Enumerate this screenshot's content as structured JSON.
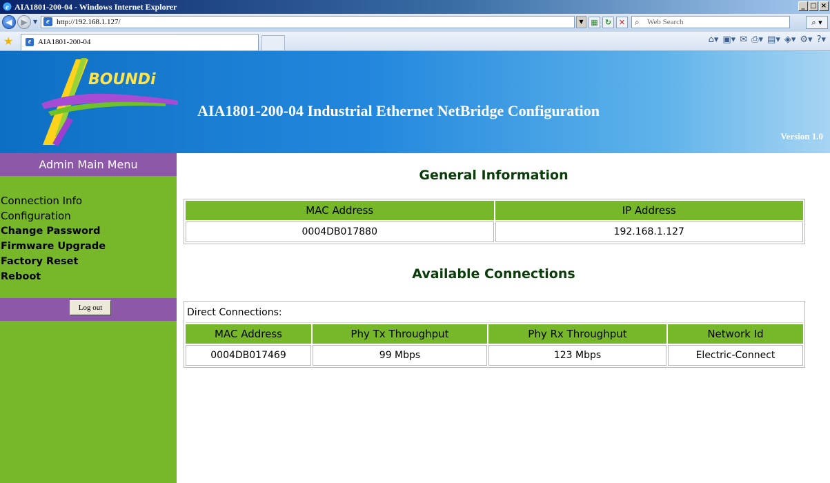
{
  "browser": {
    "window_title": "AIA1801-200-04 - Windows Internet Explorer",
    "url": "http://192.168.1.127/",
    "search_placeholder": "Web Search",
    "tab_label": "AIA1801-200-04",
    "window_buttons": {
      "minimize": "_",
      "maximize": "□",
      "close": "×"
    }
  },
  "banner": {
    "logo_text": "BOUNDi",
    "title": "AIA1801-200-04 Industrial Ethernet NetBridge Configuration",
    "version": "Version 1.0",
    "colors": {
      "banner_start": "#0d6fc4",
      "banner_end": "#a7d4f2"
    }
  },
  "sidebar": {
    "header": "Admin Main Menu",
    "items": [
      {
        "label": "Connection Info"
      },
      {
        "label": "Configuration"
      },
      {
        "label": "Change Password"
      },
      {
        "label": "Firmware Upgrade"
      },
      {
        "label": "Factory Reset"
      },
      {
        "label": "Reboot"
      }
    ],
    "logout_label": "Log out",
    "colors": {
      "menu_bg": "#76b82a",
      "header_bg": "#8e58a8"
    }
  },
  "general": {
    "title": "General Information",
    "columns": [
      "MAC Address",
      "IP Address"
    ],
    "row": [
      "0004DB017880",
      "192.168.1.127"
    ]
  },
  "connections": {
    "title": "Available Connections",
    "caption": "Direct Connections:",
    "columns": [
      "MAC Address",
      "Phy Tx Throughput",
      "Phy Rx Throughput",
      "Network Id"
    ],
    "rows": [
      [
        "0004DB017469",
        "99 Mbps",
        "123 Mbps",
        "Electric-Connect"
      ]
    ]
  },
  "icons": [
    "ie-logo",
    "back-arrow-icon",
    "forward-arrow-icon",
    "refresh-icon",
    "stop-icon",
    "search-icon",
    "favorites-star-icon",
    "home-icon",
    "feeds-icon",
    "mail-icon",
    "print-icon",
    "page-icon",
    "tools-icon",
    "help-icon"
  ]
}
